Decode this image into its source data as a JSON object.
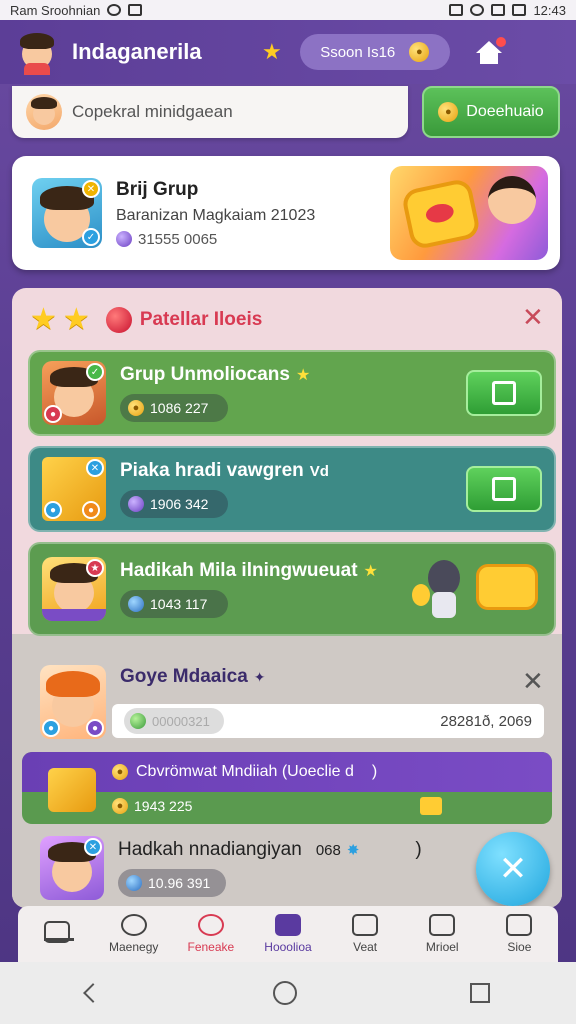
{
  "status_bar": {
    "left_text": "Ram Sroohnian",
    "time": "12:43"
  },
  "header": {
    "title": "Indaganerila",
    "coin_pill_value": "Ssoon Is16"
  },
  "search": {
    "placeholder": "Copekral minidgaean",
    "action_label": "Doeehuaio"
  },
  "featured": {
    "title": "Brij Grup",
    "subtitle": "Baranizan Magkaiam 21023",
    "meta": "31555 0065"
  },
  "panel": {
    "title": "Patellar Iloeis",
    "rows": [
      {
        "title": "Grup Unmoliocans",
        "meta": "1086 227",
        "color": "#62a54e"
      },
      {
        "title": "Piaka hradi vawgren",
        "title_suffix": "Vd",
        "meta": "1906 342",
        "color": "#3d8a86"
      },
      {
        "title": "Hadikah Mila ilningwueuat",
        "meta": "1043 117",
        "color": "#5c9c50"
      }
    ],
    "second_section": {
      "title": "Goye Mdaaica",
      "pill_text": "00000321",
      "right_value": "28281ð, 2069"
    },
    "banner": {
      "top_text": "Cbvrömwat Mndiiah (Uoeclie d",
      "top_suffix": ")",
      "bottom_value": "1943 225"
    },
    "last_row": {
      "title": "Hadkah nnadiangiyan",
      "extra": "068",
      "suffix": ")",
      "meta": "10.96 391"
    }
  },
  "bottom_nav": {
    "items": [
      {
        "label": "",
        "state": "home"
      },
      {
        "label": "Maenegy",
        "state": "normal"
      },
      {
        "label": "Feneake",
        "state": "active"
      },
      {
        "label": "Hooolioa",
        "state": "purple"
      },
      {
        "label": "Veat",
        "state": "normal"
      },
      {
        "label": "Mrioel",
        "state": "normal"
      },
      {
        "label": "Sioe",
        "state": "normal"
      }
    ]
  },
  "colors": {
    "accent_purple": "#6a4aa1",
    "green": "#5cc15a",
    "teal": "#3d8a86",
    "red_title": "#d83a52",
    "fab_blue": "#1fa5dd"
  }
}
